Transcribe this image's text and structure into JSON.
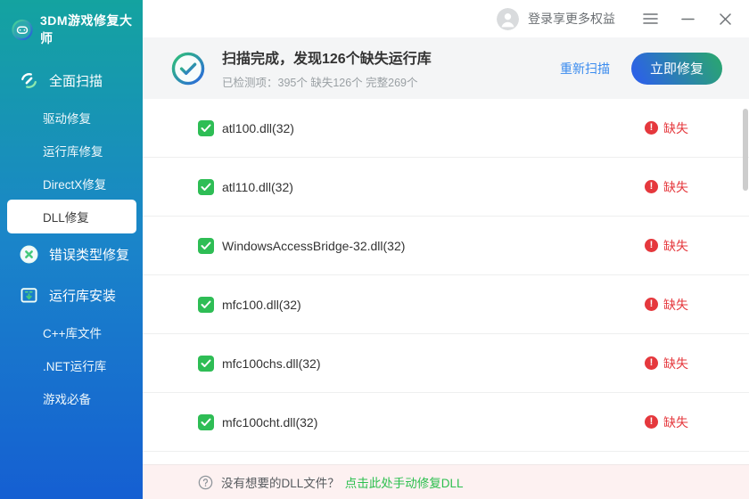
{
  "sidebar": {
    "logo_title": "3DM游戏修复大师",
    "items": [
      {
        "label": "全面扫描",
        "level": "top",
        "icon": "scan-wrench"
      },
      {
        "label": "驱动修复",
        "level": "sub"
      },
      {
        "label": "运行库修复",
        "level": "sub"
      },
      {
        "label": "DirectX修复",
        "level": "sub"
      },
      {
        "label": "DLL修复",
        "level": "sub",
        "selected": true
      },
      {
        "label": "错误类型修复",
        "level": "top",
        "icon": "x-circle"
      },
      {
        "label": "运行库安装",
        "level": "top",
        "icon": "install-window"
      },
      {
        "label": "C++库文件",
        "level": "sub"
      },
      {
        "label": ".NET运行库",
        "level": "sub"
      },
      {
        "label": "游戏必备",
        "level": "sub"
      }
    ]
  },
  "titlebar": {
    "login_label": "登录享更多权益"
  },
  "banner": {
    "title": "扫描完成，发现126个缺失运行库",
    "detail": "已检测项：395个 缺失126个 完整269个",
    "rescan_label": "重新扫描",
    "fix_label": "立即修复"
  },
  "rows": [
    {
      "name": "atl100.dll(32)",
      "status": "缺失",
      "checked": true
    },
    {
      "name": "atl110.dll(32)",
      "status": "缺失",
      "checked": true
    },
    {
      "name": "WindowsAccessBridge-32.dll(32)",
      "status": "缺失",
      "checked": true
    },
    {
      "name": "mfc100.dll(32)",
      "status": "缺失",
      "checked": true
    },
    {
      "name": "mfc100chs.dll(32)",
      "status": "缺失",
      "checked": true
    },
    {
      "name": "mfc100cht.dll(32)",
      "status": "缺失",
      "checked": true
    }
  ],
  "footer": {
    "text": "没有想要的DLL文件？",
    "link_label": "点击此处手动修复DLL"
  },
  "glyphs": {
    "exclamation": "!",
    "question": "?"
  },
  "colors": {
    "sidebar_top": "#14a3a0",
    "sidebar_bottom": "#155fd2",
    "checkbox_green": "#2ebd55",
    "missing_red": "#e5383d",
    "rescan_blue": "#3a8bee",
    "fix_gradient_start": "#2c63e4",
    "fix_gradient_end": "#2aa572",
    "footer_bg": "#fdf1f1",
    "footer_link_green": "#2cbf4e",
    "banner_bg": "#f4f5f6"
  }
}
